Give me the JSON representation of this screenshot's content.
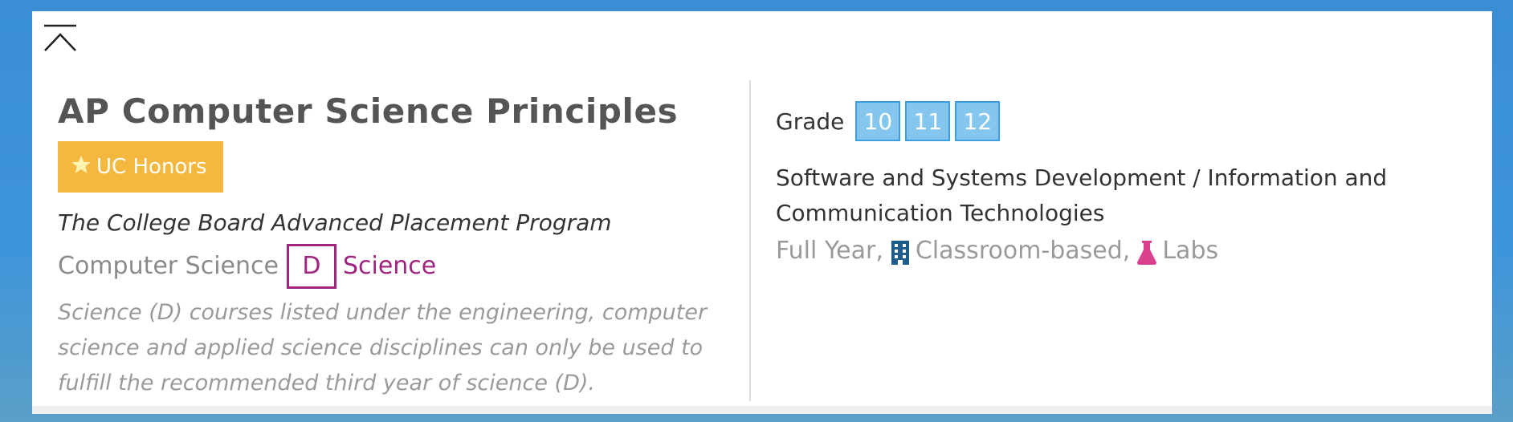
{
  "course": {
    "title": "AP Computer Science Principles",
    "honors_badge": "UC Honors",
    "program": "The College Board Advanced Placement Program",
    "subject": "Computer Science",
    "requirement_letter": "D",
    "requirement_name": "Science",
    "note": "Science (D) courses listed under the engineering, computer science and applied science disciplines can only be used to fulfill the recommended third year of science (D)."
  },
  "details": {
    "grade_label": "Grade",
    "grades": [
      "10",
      "11",
      "12"
    ],
    "pathway": "Software and Systems Development / Information and Communication Technologies",
    "duration": "Full Year,",
    "format": "Classroom-based,",
    "labs": "Labs"
  },
  "icons": {
    "collapse": "collapse-up-icon",
    "honors": "star-icon",
    "format": "building-icon",
    "labs": "flask-icon"
  },
  "colors": {
    "honors_bg": "#f5b83e",
    "requirement": "#a02380",
    "grade_chip": "#84c6ee",
    "building_icon": "#1c5d8c",
    "flask_icon": "#d9418f"
  }
}
